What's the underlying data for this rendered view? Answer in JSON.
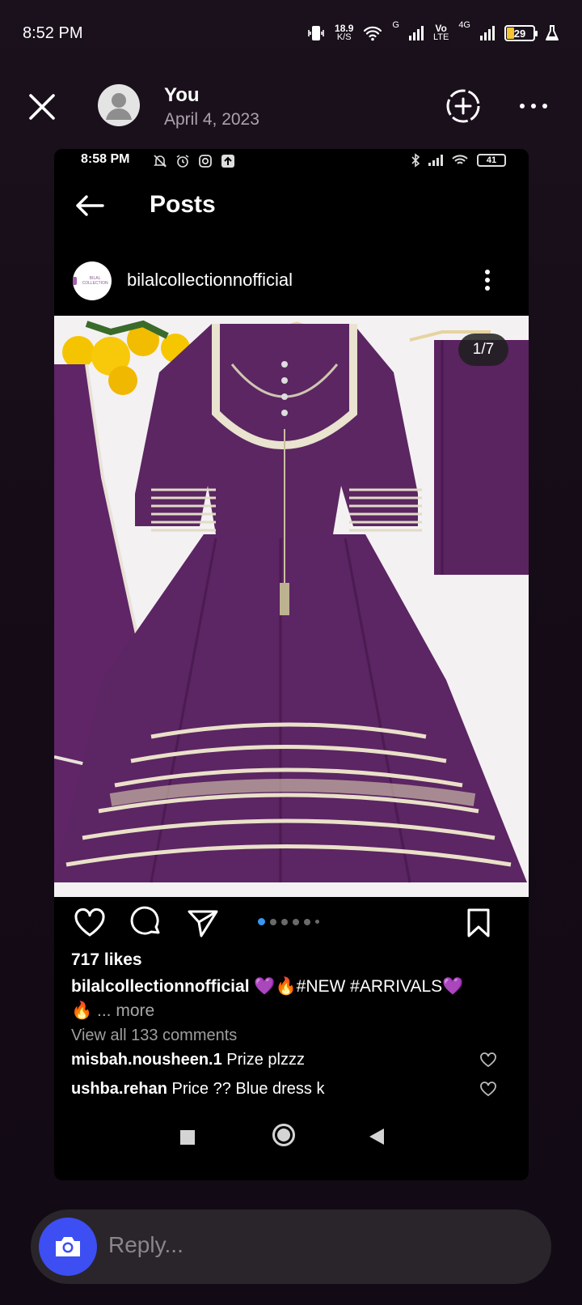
{
  "status_bar": {
    "time": "8:52 PM",
    "net_speed_value": "18.9",
    "net_speed_unit": "K/S",
    "signal1_label": "G",
    "volte_label_top": "Vo",
    "volte_label_bottom": "LTE",
    "signal2_label": "4G",
    "battery": "29"
  },
  "story": {
    "user": "You",
    "date": "April 4, 2023"
  },
  "inner_status": {
    "time": "8:58 PM",
    "battery": "41"
  },
  "post_screen": {
    "title": "Posts",
    "username": "bilalcollectionnofficial",
    "brand_logo_text": "BILAL COLLECTION",
    "image_counter": "1/7",
    "likes": "717 likes",
    "caption_user": "bilalcollectionnofficial",
    "caption_text": "💜🔥#NEW #ARRIVALS💜",
    "caption_line2": "🔥",
    "caption_more": "... more",
    "view_comments": "View all 133 comments",
    "comments": [
      {
        "user": "misbah.nousheen.1",
        "text": "Prize plzzz"
      },
      {
        "user": "ushba.rehan",
        "text": "Price ?? Blue dress k"
      }
    ]
  },
  "reply": {
    "placeholder": "Reply..."
  },
  "colors": {
    "accent_blue": "#3897f0",
    "camera_button": "#3d4ef2",
    "dress_purple": "#5b2662"
  }
}
